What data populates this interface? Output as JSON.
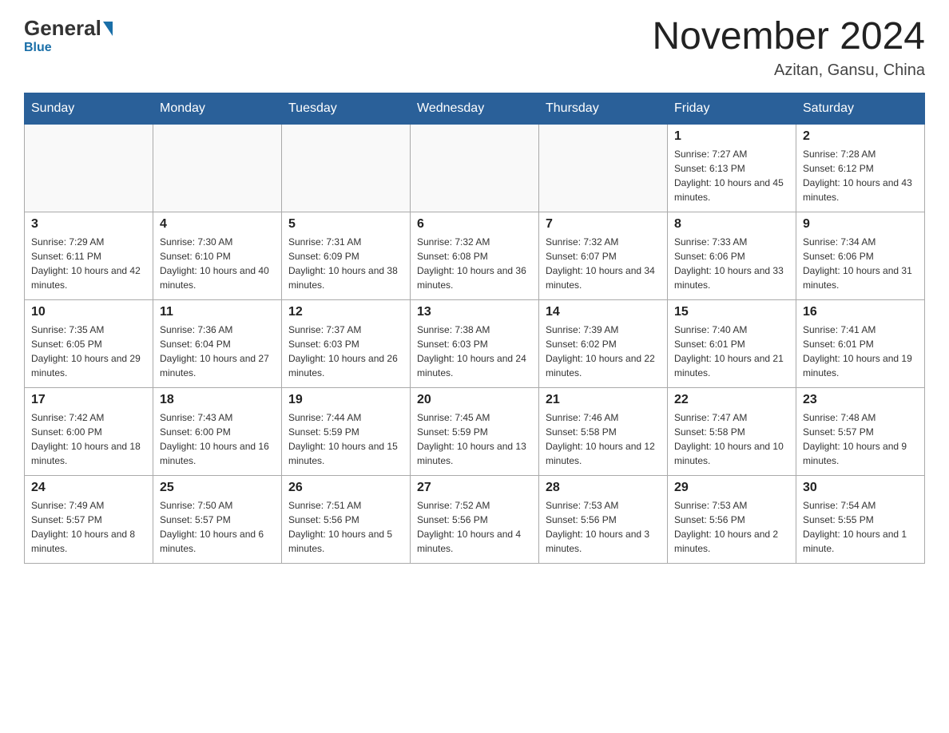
{
  "header": {
    "logo_general": "General",
    "logo_blue": "Blue",
    "month_title": "November 2024",
    "location": "Azitan, Gansu, China"
  },
  "days_of_week": [
    "Sunday",
    "Monday",
    "Tuesday",
    "Wednesday",
    "Thursday",
    "Friday",
    "Saturday"
  ],
  "weeks": [
    [
      {
        "day": "",
        "sunrise": "",
        "sunset": "",
        "daylight": "",
        "empty": true
      },
      {
        "day": "",
        "sunrise": "",
        "sunset": "",
        "daylight": "",
        "empty": true
      },
      {
        "day": "",
        "sunrise": "",
        "sunset": "",
        "daylight": "",
        "empty": true
      },
      {
        "day": "",
        "sunrise": "",
        "sunset": "",
        "daylight": "",
        "empty": true
      },
      {
        "day": "",
        "sunrise": "",
        "sunset": "",
        "daylight": "",
        "empty": true
      },
      {
        "day": "1",
        "sunrise": "Sunrise: 7:27 AM",
        "sunset": "Sunset: 6:13 PM",
        "daylight": "Daylight: 10 hours and 45 minutes.",
        "empty": false
      },
      {
        "day": "2",
        "sunrise": "Sunrise: 7:28 AM",
        "sunset": "Sunset: 6:12 PM",
        "daylight": "Daylight: 10 hours and 43 minutes.",
        "empty": false
      }
    ],
    [
      {
        "day": "3",
        "sunrise": "Sunrise: 7:29 AM",
        "sunset": "Sunset: 6:11 PM",
        "daylight": "Daylight: 10 hours and 42 minutes.",
        "empty": false
      },
      {
        "day": "4",
        "sunrise": "Sunrise: 7:30 AM",
        "sunset": "Sunset: 6:10 PM",
        "daylight": "Daylight: 10 hours and 40 minutes.",
        "empty": false
      },
      {
        "day": "5",
        "sunrise": "Sunrise: 7:31 AM",
        "sunset": "Sunset: 6:09 PM",
        "daylight": "Daylight: 10 hours and 38 minutes.",
        "empty": false
      },
      {
        "day": "6",
        "sunrise": "Sunrise: 7:32 AM",
        "sunset": "Sunset: 6:08 PM",
        "daylight": "Daylight: 10 hours and 36 minutes.",
        "empty": false
      },
      {
        "day": "7",
        "sunrise": "Sunrise: 7:32 AM",
        "sunset": "Sunset: 6:07 PM",
        "daylight": "Daylight: 10 hours and 34 minutes.",
        "empty": false
      },
      {
        "day": "8",
        "sunrise": "Sunrise: 7:33 AM",
        "sunset": "Sunset: 6:06 PM",
        "daylight": "Daylight: 10 hours and 33 minutes.",
        "empty": false
      },
      {
        "day": "9",
        "sunrise": "Sunrise: 7:34 AM",
        "sunset": "Sunset: 6:06 PM",
        "daylight": "Daylight: 10 hours and 31 minutes.",
        "empty": false
      }
    ],
    [
      {
        "day": "10",
        "sunrise": "Sunrise: 7:35 AM",
        "sunset": "Sunset: 6:05 PM",
        "daylight": "Daylight: 10 hours and 29 minutes.",
        "empty": false
      },
      {
        "day": "11",
        "sunrise": "Sunrise: 7:36 AM",
        "sunset": "Sunset: 6:04 PM",
        "daylight": "Daylight: 10 hours and 27 minutes.",
        "empty": false
      },
      {
        "day": "12",
        "sunrise": "Sunrise: 7:37 AM",
        "sunset": "Sunset: 6:03 PM",
        "daylight": "Daylight: 10 hours and 26 minutes.",
        "empty": false
      },
      {
        "day": "13",
        "sunrise": "Sunrise: 7:38 AM",
        "sunset": "Sunset: 6:03 PM",
        "daylight": "Daylight: 10 hours and 24 minutes.",
        "empty": false
      },
      {
        "day": "14",
        "sunrise": "Sunrise: 7:39 AM",
        "sunset": "Sunset: 6:02 PM",
        "daylight": "Daylight: 10 hours and 22 minutes.",
        "empty": false
      },
      {
        "day": "15",
        "sunrise": "Sunrise: 7:40 AM",
        "sunset": "Sunset: 6:01 PM",
        "daylight": "Daylight: 10 hours and 21 minutes.",
        "empty": false
      },
      {
        "day": "16",
        "sunrise": "Sunrise: 7:41 AM",
        "sunset": "Sunset: 6:01 PM",
        "daylight": "Daylight: 10 hours and 19 minutes.",
        "empty": false
      }
    ],
    [
      {
        "day": "17",
        "sunrise": "Sunrise: 7:42 AM",
        "sunset": "Sunset: 6:00 PM",
        "daylight": "Daylight: 10 hours and 18 minutes.",
        "empty": false
      },
      {
        "day": "18",
        "sunrise": "Sunrise: 7:43 AM",
        "sunset": "Sunset: 6:00 PM",
        "daylight": "Daylight: 10 hours and 16 minutes.",
        "empty": false
      },
      {
        "day": "19",
        "sunrise": "Sunrise: 7:44 AM",
        "sunset": "Sunset: 5:59 PM",
        "daylight": "Daylight: 10 hours and 15 minutes.",
        "empty": false
      },
      {
        "day": "20",
        "sunrise": "Sunrise: 7:45 AM",
        "sunset": "Sunset: 5:59 PM",
        "daylight": "Daylight: 10 hours and 13 minutes.",
        "empty": false
      },
      {
        "day": "21",
        "sunrise": "Sunrise: 7:46 AM",
        "sunset": "Sunset: 5:58 PM",
        "daylight": "Daylight: 10 hours and 12 minutes.",
        "empty": false
      },
      {
        "day": "22",
        "sunrise": "Sunrise: 7:47 AM",
        "sunset": "Sunset: 5:58 PM",
        "daylight": "Daylight: 10 hours and 10 minutes.",
        "empty": false
      },
      {
        "day": "23",
        "sunrise": "Sunrise: 7:48 AM",
        "sunset": "Sunset: 5:57 PM",
        "daylight": "Daylight: 10 hours and 9 minutes.",
        "empty": false
      }
    ],
    [
      {
        "day": "24",
        "sunrise": "Sunrise: 7:49 AM",
        "sunset": "Sunset: 5:57 PM",
        "daylight": "Daylight: 10 hours and 8 minutes.",
        "empty": false
      },
      {
        "day": "25",
        "sunrise": "Sunrise: 7:50 AM",
        "sunset": "Sunset: 5:57 PM",
        "daylight": "Daylight: 10 hours and 6 minutes.",
        "empty": false
      },
      {
        "day": "26",
        "sunrise": "Sunrise: 7:51 AM",
        "sunset": "Sunset: 5:56 PM",
        "daylight": "Daylight: 10 hours and 5 minutes.",
        "empty": false
      },
      {
        "day": "27",
        "sunrise": "Sunrise: 7:52 AM",
        "sunset": "Sunset: 5:56 PM",
        "daylight": "Daylight: 10 hours and 4 minutes.",
        "empty": false
      },
      {
        "day": "28",
        "sunrise": "Sunrise: 7:53 AM",
        "sunset": "Sunset: 5:56 PM",
        "daylight": "Daylight: 10 hours and 3 minutes.",
        "empty": false
      },
      {
        "day": "29",
        "sunrise": "Sunrise: 7:53 AM",
        "sunset": "Sunset: 5:56 PM",
        "daylight": "Daylight: 10 hours and 2 minutes.",
        "empty": false
      },
      {
        "day": "30",
        "sunrise": "Sunrise: 7:54 AM",
        "sunset": "Sunset: 5:55 PM",
        "daylight": "Daylight: 10 hours and 1 minute.",
        "empty": false
      }
    ]
  ]
}
